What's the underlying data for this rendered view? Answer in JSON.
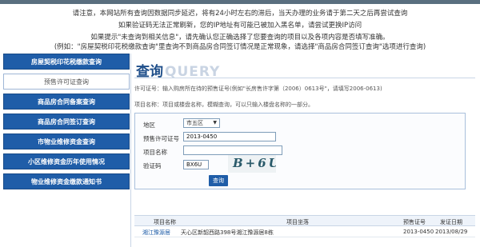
{
  "notices": [
    "请注意，本网站所有查询因数据同步延迟，将有24小时左右的滞后，当天办理的业务请于第二天之后再尝试查询",
    "如果验证码无法正常刷新，您的IP地址有可能已被加入黑名单，请尝试更换IP访问",
    "如果提示\"未查询到相关信息\"，请先确认您正确选择了您要查询的项目以及各项内容是否填写准确。",
    "(例如：\"房屋契税印花税缴款查询\"里查询不到商品房合同签订情况是正常现象，请选择\"商品房合同签订查询\"选项进行查询)"
  ],
  "sidebar": {
    "items": [
      {
        "label": "房屋契税印花税缴款查询"
      },
      {
        "label": "预售许可证查询"
      },
      {
        "label": "商品房合同备案查询"
      },
      {
        "label": "商品房合同签订查询"
      },
      {
        "label": "市物业维修资金查询"
      },
      {
        "label": "小区维修资金历年使用情况"
      },
      {
        "label": "物业维修资金缴款通知书"
      }
    ],
    "active_index": 1
  },
  "main": {
    "title_cn": "查询",
    "title_en": "QUERY",
    "hint_permit": "许可证号：输入购房所在待的预售证号(例如\"长房售许字第（2006）0613号\"，请填写2006-0613)",
    "hint_project": "项目名称：项目或楼盘名称，模糊查询，可以只输入楼盘名称的一部分。"
  },
  "form": {
    "district_label": "地区",
    "district_value": "市五区",
    "permit_label": "预售许可证号",
    "permit_value": "2013-0450",
    "project_label": "项目名称",
    "project_value": "",
    "captcha_label": "验证码",
    "captcha_value": "BX6U",
    "captcha_image_text": "B+6U",
    "search_label": "查询"
  },
  "results": {
    "headers": [
      "项目名称",
      "项目坐落",
      "预售证号",
      "发证日期"
    ],
    "rows": [
      [
        "湘江豫源居",
        "天心区新韶西路398号湘江豫源居8栋",
        "2013-0450",
        "2013/08/29"
      ]
    ]
  },
  "colors": {
    "accent": "#1f5da8",
    "top_strip": "#5a6f7f"
  }
}
